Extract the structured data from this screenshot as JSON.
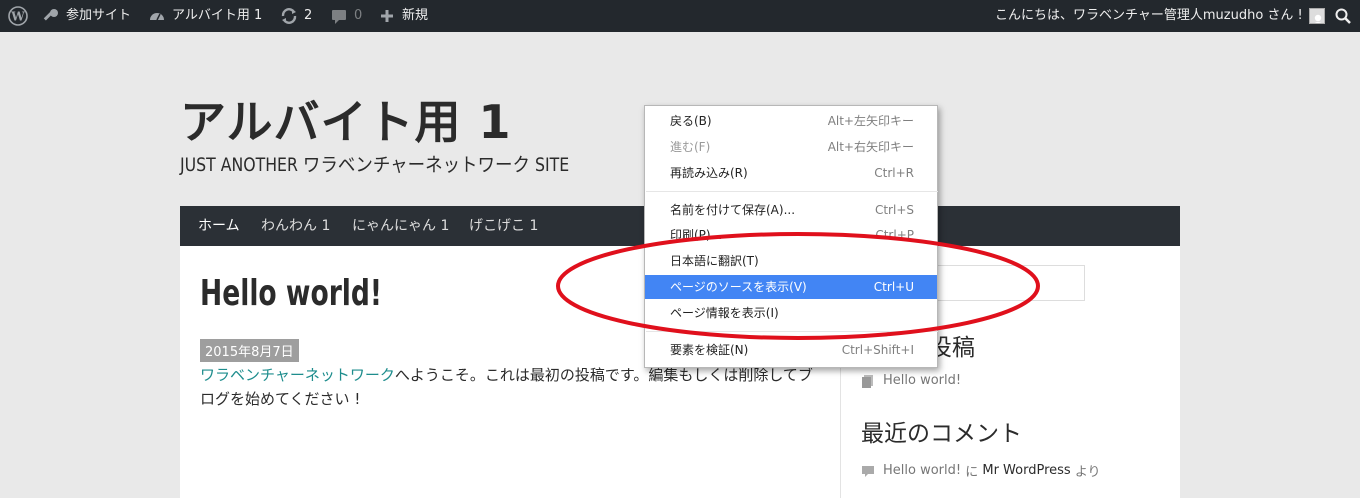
{
  "adminbar": {
    "my_sites": "参加サイト",
    "site_name": "アルバイト用 1",
    "updates_count": "2",
    "comments_count": "0",
    "new_label": "新規",
    "greeting": "こんにちは、ワラベンチャー管理人muzudho さん !"
  },
  "header": {
    "site_title": "アルバイト用 1",
    "site_description": "JUST ANOTHER ワラベンチャーネットワーク SITE"
  },
  "nav": {
    "items": [
      "ホーム",
      "わんわん 1",
      "にゃんにゃん 1",
      "げこげこ 1"
    ]
  },
  "post": {
    "title": "Hello world!",
    "date": "2015年8月7日",
    "link_text": "ワラベンチャーネットワーク",
    "body_rest": "へようこそ。これは最初の投稿です。編集もしくは削除してブログを始めてください !"
  },
  "sidebar": {
    "recent_posts_title_visible": "投稿",
    "recent_post_item": "Hello world!",
    "recent_comments_title": "最近のコメント",
    "comment_post": "Hello world!",
    "comment_on": " に ",
    "comment_author": "Mr WordPress",
    "comment_suffix": " より"
  },
  "context_menu": {
    "items": [
      {
        "label": "戻る(B)",
        "shortcut": "Alt+左矢印キー"
      },
      {
        "label": "進む(F)",
        "shortcut": "Alt+右矢印キー"
      },
      {
        "label": "再読み込み(R)",
        "shortcut": "Ctrl+R"
      },
      {
        "label": "名前を付けて保存(A)...",
        "shortcut": "Ctrl+S"
      },
      {
        "label": "印刷(P)...",
        "shortcut": "Ctrl+P"
      },
      {
        "label": "日本語に翻訳(T)",
        "shortcut": ""
      },
      {
        "label": "ページのソースを表示(V)",
        "shortcut": "Ctrl+U"
      },
      {
        "label": "ページ情報を表示(I)",
        "shortcut": ""
      },
      {
        "label": "要素を検証(N)",
        "shortcut": "Ctrl+Shift+I"
      }
    ],
    "highlight_color": "#4285f4"
  },
  "colors": {
    "annotation": "#e0101c",
    "adminbar_bg": "#23282d",
    "nav_bg": "#2b3036",
    "link": "#1e8d8d"
  }
}
